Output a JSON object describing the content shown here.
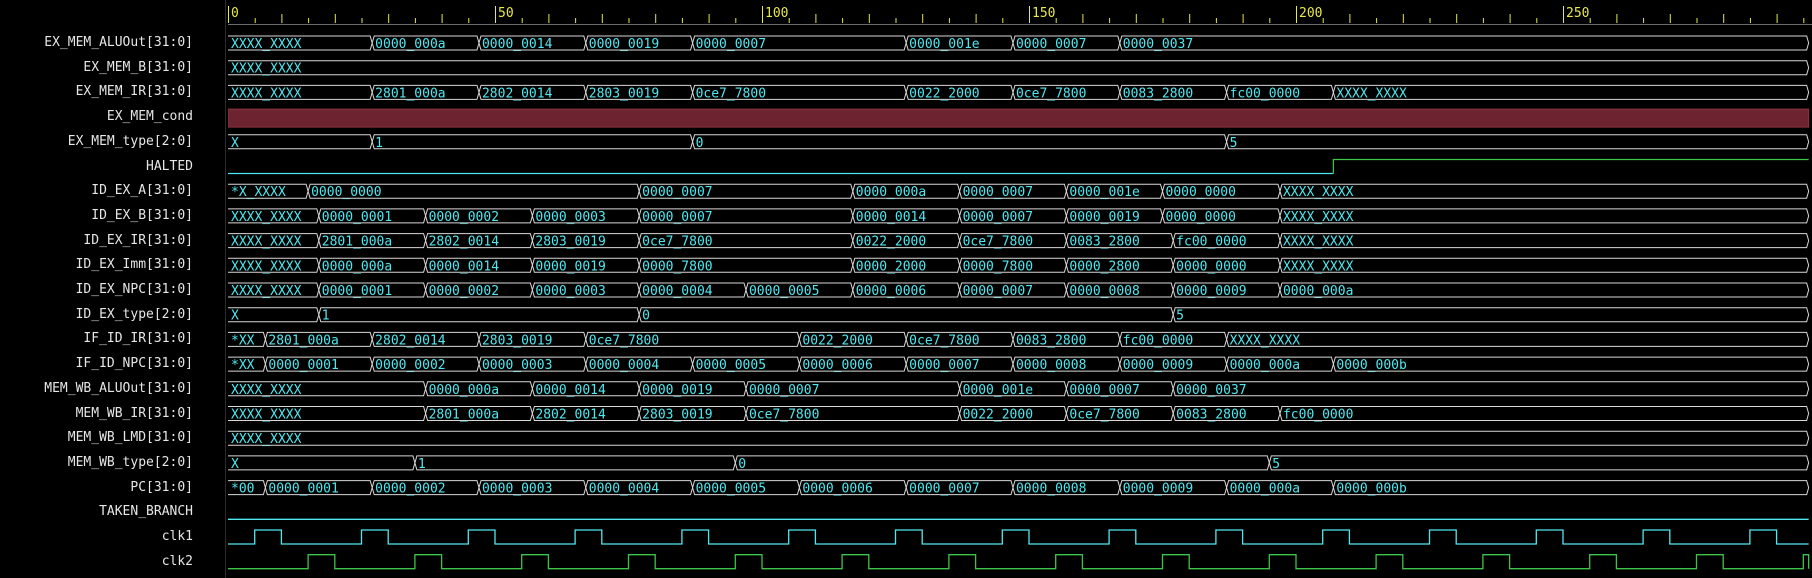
{
  "colors": {
    "background": "#000000",
    "signal_name": "#e6e6e6",
    "bus_value_text": "#4fe8f0",
    "bus_outline": "#d8d8d8",
    "ruler": "#e8e84a",
    "cond_fill": "#6e2330",
    "halted_low": "#4fe8f0",
    "halted_high": "#3ec34a",
    "clk1": "#4fe8f0",
    "clk2": "#3ec34a"
  },
  "ruler": {
    "max": 296,
    "labels": [
      "0",
      "50",
      "100",
      "150",
      "200",
      "250"
    ],
    "label_values": [
      0,
      50,
      100,
      150,
      200,
      250
    ]
  },
  "signals": [
    {
      "name": "EX_MEM_ALUOut[31:0]",
      "kind": "bus",
      "segments": [
        [
          0,
          "XXXX_XXXX"
        ],
        [
          27,
          "0000_000a"
        ],
        [
          47,
          "0000_0014"
        ],
        [
          67,
          "0000_0019"
        ],
        [
          87,
          "0000_0007"
        ],
        [
          127,
          "0000_001e"
        ],
        [
          147,
          "0000_0007"
        ],
        [
          167,
          "0000_0037"
        ]
      ]
    },
    {
      "name": "EX_MEM_B[31:0]",
      "kind": "bus",
      "segments": [
        [
          0,
          "XXXX_XXXX"
        ]
      ]
    },
    {
      "name": "EX_MEM_IR[31:0]",
      "kind": "bus",
      "segments": [
        [
          0,
          "XXXX_XXXX"
        ],
        [
          27,
          "2801_000a"
        ],
        [
          47,
          "2802_0014"
        ],
        [
          67,
          "2803_0019"
        ],
        [
          87,
          "0ce7_7800"
        ],
        [
          127,
          "0022_2000"
        ],
        [
          147,
          "0ce7_7800"
        ],
        [
          167,
          "0083_2800"
        ],
        [
          187,
          "fc00_0000"
        ],
        [
          207,
          "XXXX_XXXX"
        ]
      ]
    },
    {
      "name": "EX_MEM_cond",
      "kind": "x"
    },
    {
      "name": "EX_MEM_type[2:0]",
      "kind": "bus",
      "segments": [
        [
          0,
          "X"
        ],
        [
          27,
          "1"
        ],
        [
          87,
          "0"
        ],
        [
          187,
          "5"
        ]
      ]
    },
    {
      "name": "HALTED",
      "kind": "bit",
      "low_until": 207
    },
    {
      "name": "ID_EX_A[31:0]",
      "kind": "bus",
      "segments": [
        [
          0,
          "*X_XXXX"
        ],
        [
          15,
          "0000_0000"
        ],
        [
          77,
          "0000_0007"
        ],
        [
          117,
          "0000_000a"
        ],
        [
          137,
          "0000_0007"
        ],
        [
          157,
          "0000_001e"
        ],
        [
          175,
          "0000_0000"
        ],
        [
          197,
          "XXXX_XXXX"
        ]
      ]
    },
    {
      "name": "ID_EX_B[31:0]",
      "kind": "bus",
      "segments": [
        [
          0,
          "XXXX_XXXX"
        ],
        [
          17,
          "0000_0001"
        ],
        [
          37,
          "0000_0002"
        ],
        [
          57,
          "0000_0003"
        ],
        [
          77,
          "0000_0007"
        ],
        [
          117,
          "0000_0014"
        ],
        [
          137,
          "0000_0007"
        ],
        [
          157,
          "0000_0019"
        ],
        [
          175,
          "0000_0000"
        ],
        [
          197,
          "XXXX_XXXX"
        ]
      ]
    },
    {
      "name": "ID_EX_IR[31:0]",
      "kind": "bus",
      "segments": [
        [
          0,
          "XXXX_XXXX"
        ],
        [
          17,
          "2801_000a"
        ],
        [
          37,
          "2802_0014"
        ],
        [
          57,
          "2803_0019"
        ],
        [
          77,
          "0ce7_7800"
        ],
        [
          117,
          "0022_2000"
        ],
        [
          137,
          "0ce7_7800"
        ],
        [
          157,
          "0083_2800"
        ],
        [
          177,
          "fc00_0000"
        ],
        [
          197,
          "XXXX_XXXX"
        ]
      ]
    },
    {
      "name": "ID_EX_Imm[31:0]",
      "kind": "bus",
      "segments": [
        [
          0,
          "XXXX_XXXX"
        ],
        [
          17,
          "0000_000a"
        ],
        [
          37,
          "0000_0014"
        ],
        [
          57,
          "0000_0019"
        ],
        [
          77,
          "0000_7800"
        ],
        [
          117,
          "0000_2000"
        ],
        [
          137,
          "0000_7800"
        ],
        [
          157,
          "0000_2800"
        ],
        [
          177,
          "0000_0000"
        ],
        [
          197,
          "XXXX_XXXX"
        ]
      ]
    },
    {
      "name": "ID_EX_NPC[31:0]",
      "kind": "bus",
      "segments": [
        [
          0,
          "XXXX_XXXX"
        ],
        [
          17,
          "0000_0001"
        ],
        [
          37,
          "0000_0002"
        ],
        [
          57,
          "0000_0003"
        ],
        [
          77,
          "0000_0004"
        ],
        [
          97,
          "0000_0005"
        ],
        [
          117,
          "0000_0006"
        ],
        [
          137,
          "0000_0007"
        ],
        [
          157,
          "0000_0008"
        ],
        [
          177,
          "0000_0009"
        ],
        [
          197,
          "0000_000a"
        ]
      ]
    },
    {
      "name": "ID_EX_type[2:0]",
      "kind": "bus",
      "segments": [
        [
          0,
          "X"
        ],
        [
          17,
          "1"
        ],
        [
          77,
          "0"
        ],
        [
          177,
          "5"
        ]
      ]
    },
    {
      "name": "IF_ID_IR[31:0]",
      "kind": "bus",
      "segments": [
        [
          0,
          "*XX"
        ],
        [
          7,
          "2801_000a"
        ],
        [
          27,
          "2802_0014"
        ],
        [
          47,
          "2803_0019"
        ],
        [
          67,
          "0ce7_7800"
        ],
        [
          107,
          "0022_2000"
        ],
        [
          127,
          "0ce7_7800"
        ],
        [
          147,
          "0083_2800"
        ],
        [
          167,
          "fc00_0000"
        ],
        [
          187,
          "XXXX_XXXX"
        ]
      ]
    },
    {
      "name": "IF_ID_NPC[31:0]",
      "kind": "bus",
      "segments": [
        [
          0,
          "*XX"
        ],
        [
          7,
          "0000_0001"
        ],
        [
          27,
          "0000_0002"
        ],
        [
          47,
          "0000_0003"
        ],
        [
          67,
          "0000_0004"
        ],
        [
          87,
          "0000_0005"
        ],
        [
          107,
          "0000_0006"
        ],
        [
          127,
          "0000_0007"
        ],
        [
          147,
          "0000_0008"
        ],
        [
          167,
          "0000_0009"
        ],
        [
          187,
          "0000_000a"
        ],
        [
          207,
          "0000_000b"
        ]
      ]
    },
    {
      "name": "MEM_WB_ALUOut[31:0]",
      "kind": "bus",
      "segments": [
        [
          0,
          "XXXX_XXXX"
        ],
        [
          37,
          "0000_000a"
        ],
        [
          57,
          "0000_0014"
        ],
        [
          77,
          "0000_0019"
        ],
        [
          97,
          "0000_0007"
        ],
        [
          137,
          "0000_001e"
        ],
        [
          157,
          "0000_0007"
        ],
        [
          177,
          "0000_0037"
        ]
      ]
    },
    {
      "name": "MEM_WB_IR[31:0]",
      "kind": "bus",
      "segments": [
        [
          0,
          "XXXX_XXXX"
        ],
        [
          37,
          "2801_000a"
        ],
        [
          57,
          "2802_0014"
        ],
        [
          77,
          "2803_0019"
        ],
        [
          97,
          "0ce7_7800"
        ],
        [
          137,
          "0022_2000"
        ],
        [
          157,
          "0ce7_7800"
        ],
        [
          177,
          "0083_2800"
        ],
        [
          197,
          "fc00_0000"
        ]
      ]
    },
    {
      "name": "MEM_WB_LMD[31:0]",
      "kind": "bus",
      "segments": [
        [
          0,
          "XXXX_XXXX"
        ]
      ]
    },
    {
      "name": "MEM_WB_type[2:0]",
      "kind": "bus",
      "segments": [
        [
          0,
          "X"
        ],
        [
          35,
          "1"
        ],
        [
          95,
          "0"
        ],
        [
          195,
          "5"
        ]
      ]
    },
    {
      "name": "PC[31:0]",
      "kind": "bus",
      "segments": [
        [
          0,
          "*00"
        ],
        [
          7,
          "0000_0001"
        ],
        [
          27,
          "0000_0002"
        ],
        [
          47,
          "0000_0003"
        ],
        [
          67,
          "0000_0004"
        ],
        [
          87,
          "0000_0005"
        ],
        [
          107,
          "0000_0006"
        ],
        [
          127,
          "0000_0007"
        ],
        [
          147,
          "0000_0008"
        ],
        [
          167,
          "0000_0009"
        ],
        [
          187,
          "0000_000a"
        ],
        [
          207,
          "0000_000b"
        ]
      ]
    },
    {
      "name": "TAKEN_BRANCH",
      "kind": "bit",
      "low_until": 296
    },
    {
      "name": "clk1",
      "kind": "clock",
      "first_rise": 5,
      "high": 5,
      "period": 20
    },
    {
      "name": "clk2",
      "kind": "clock",
      "first_rise": 15,
      "high": 5,
      "period": 20
    }
  ]
}
